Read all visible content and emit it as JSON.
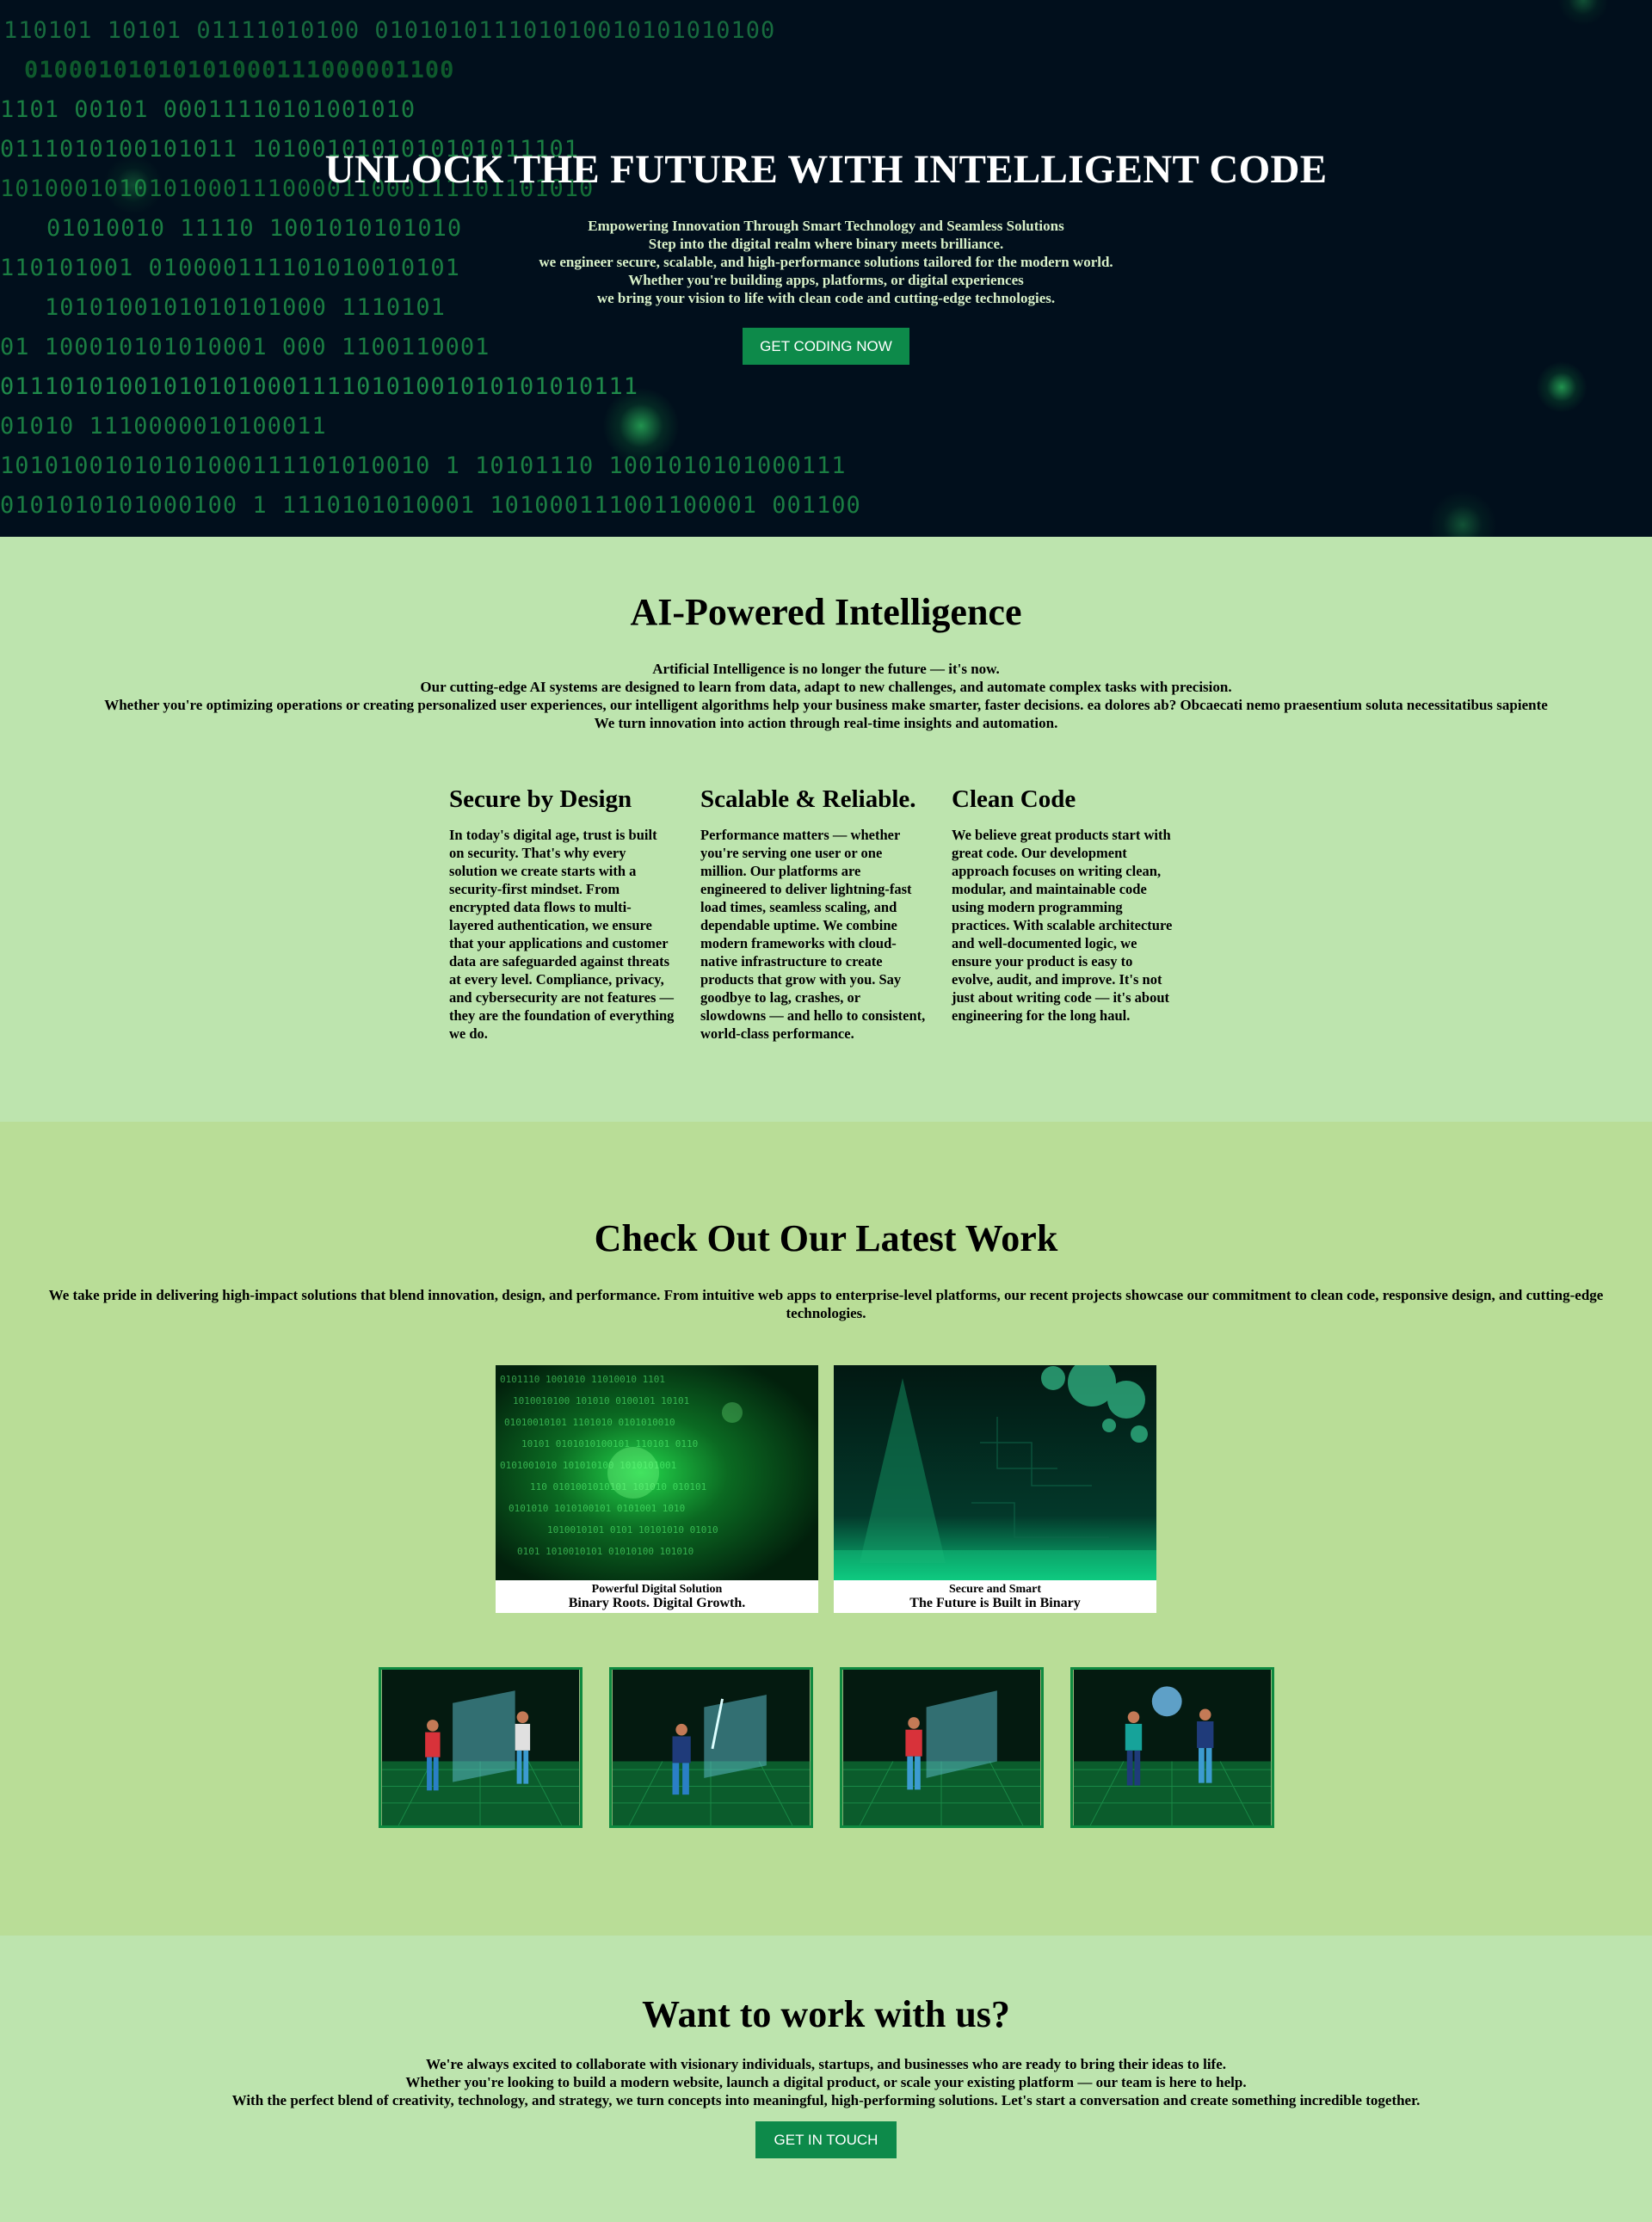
{
  "hero": {
    "title": "UNLOCK THE FUTURE WITH INTELLIGENT CODE",
    "lines": [
      "Empowering Innovation Through Smart Technology and Seamless Solutions",
      "Step into the digital realm where binary meets brilliance.",
      "we engineer secure, scalable, and high-performance solutions tailored for the modern world.",
      "Whether you're building apps, platforms, or digital experiences",
      "we bring your vision to life with clean code and cutting-edge technologies."
    ],
    "button": "GET CODING NOW",
    "binary_rows": [
      "110101    10101       01111010100     010101011101010010101010100",
      "01000101010101000111000001100",
      "1101    00101       00011110101001010",
      "0111010100101011                      1010010101010101011101",
      "1010001010101000111000011000111101101010",
      "01010010              11110    1001010101010",
      "110101001        010000111101010010101",
      "1010100101010101000  1110101",
      "01  100010101010001     000              1100110001",
      "0111010100101010100011110101001010101010111",
      "01010                    1110000010100011",
      "10101001010101000111101010010 1    10101110    1001010101000111",
      "0101010101000100 1     1110101010001      101000111001100001    001100"
    ]
  },
  "ai": {
    "title": "AI-Powered Intelligence",
    "lines": [
      "Artificial Intelligence is no longer the future — it's now.",
      "Our cutting-edge AI systems are designed to learn from data, adapt to new challenges, and automate complex tasks with precision.",
      "Whether you're optimizing operations or creating personalized user experiences, our intelligent algorithms help your business make smarter, faster decisions. ea dolores ab? Obcaecati nemo praesentium soluta necessitatibus sapiente",
      "We turn innovation into action through real-time insights and automation."
    ],
    "features": [
      {
        "title": "Secure by Design",
        "text": "In today's digital age, trust is built on security. That's why every solution we create starts with a security-first mindset. From encrypted data flows to multi-layered authentication, we ensure that your applications and customer data are safeguarded against threats at every level. Compliance, privacy, and cybersecurity are not features — they are the foundation of everything we do."
      },
      {
        "title": "Scalable & Reliable.",
        "text": "Performance matters — whether you're serving one user or one million. Our platforms are engineered to deliver lightning-fast load times, seamless scaling, and dependable uptime. We combine modern frameworks with cloud-native infrastructure to create products that grow with you. Say goodbye to lag, crashes, or slowdowns — and hello to consistent, world-class performance."
      },
      {
        "title": "Clean Code",
        "text": "We believe great products start with great code. Our development approach focuses on writing clean, modular, and maintainable code using modern programming practices. With scalable architecture and well-documented logic, we ensure your product is easy to evolve, audit, and improve. It's not just about writing code — it's about engineering for the long haul."
      }
    ]
  },
  "work": {
    "title": "Check Out Our Latest Work",
    "text": "We take pride in delivering high-impact solutions that blend innovation, design, and performance. From intuitive web apps to enterprise-level platforms, our recent projects showcase our commitment to clean code, responsive design, and cutting-edge technologies.",
    "cards": [
      {
        "kicker": "Powerful Digital Solution",
        "title": "Binary Roots. Digital Growth."
      },
      {
        "kicker": "Secure and Smart",
        "title": "The Future is Built in Binary"
      }
    ],
    "thumbs": [
      "vr-collaboration-image",
      "vr-sword-image",
      "vr-panel-image",
      "vr-globe-image"
    ]
  },
  "contact": {
    "title": "Want to work with us?",
    "lines": [
      "We're always excited to collaborate with visionary individuals, startups, and businesses who are ready to bring their ideas to life.",
      "Whether you're looking to build a modern website, launch a digital product, or scale your existing platform — our team is here to help.",
      "With the perfect blend of creativity, technology, and strategy, we turn concepts into meaningful, high-performing solutions. Let's start a conversation and create something incredible together."
    ],
    "button": "GET IN TOUCH"
  },
  "colors": {
    "hero_bg": "#010f1c",
    "ai_bg": "#bde4ae",
    "work_bg": "#b9dd97",
    "accent": "#0d8a4a"
  }
}
